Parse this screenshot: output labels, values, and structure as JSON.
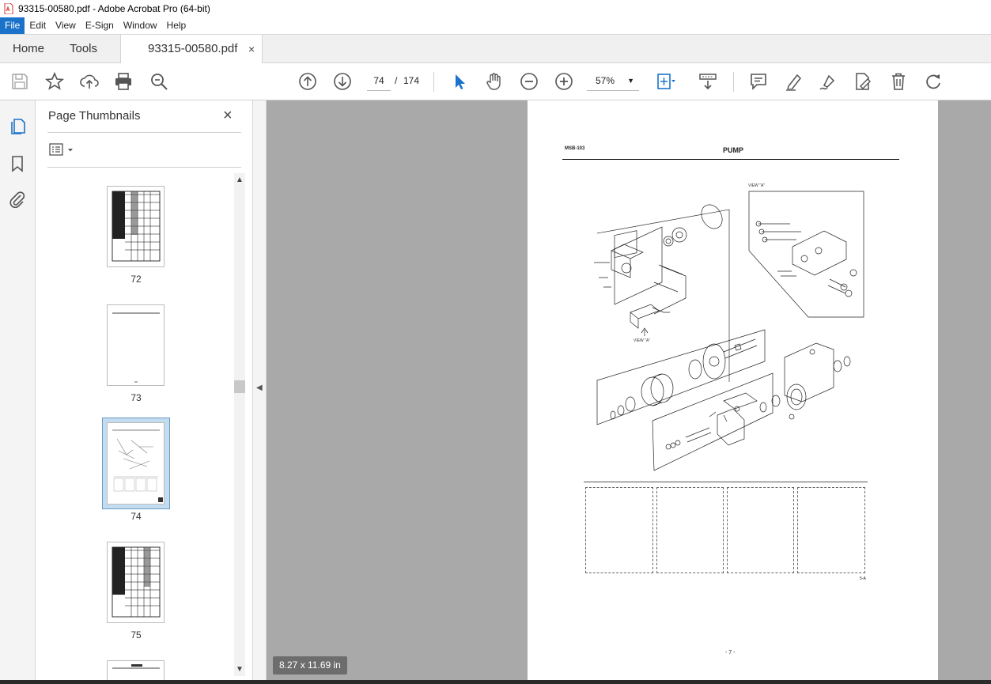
{
  "window": {
    "title": "93315-00580.pdf - Adobe Acrobat Pro (64-bit)"
  },
  "menu": [
    "File",
    "Edit",
    "View",
    "E-Sign",
    "Window",
    "Help"
  ],
  "tabs": {
    "home": "Home",
    "tools": "Tools",
    "document": "93315-00580.pdf",
    "close": "×"
  },
  "toolbar": {
    "current_page": "74",
    "separator": "/",
    "total_pages": "174",
    "zoom": "57%"
  },
  "panel": {
    "title": "Page Thumbnails",
    "close": "×",
    "thumbnails": [
      {
        "label": "72",
        "selected": false
      },
      {
        "label": "73",
        "selected": false
      },
      {
        "label": "74",
        "selected": true
      },
      {
        "label": "75",
        "selected": false
      }
    ]
  },
  "document": {
    "header_code": "MSB-103",
    "header_title": "PUMP",
    "page_footer": "- 7 -",
    "page_ref": "5-A",
    "view_a_label": "VIEW \"A\""
  },
  "status": {
    "page_size": "8.27 x 11.69 in"
  },
  "colors": {
    "menu_active": "#1a73c9",
    "doc_bg": "#a9a9a9",
    "accent_icon": "#1a73c9"
  }
}
